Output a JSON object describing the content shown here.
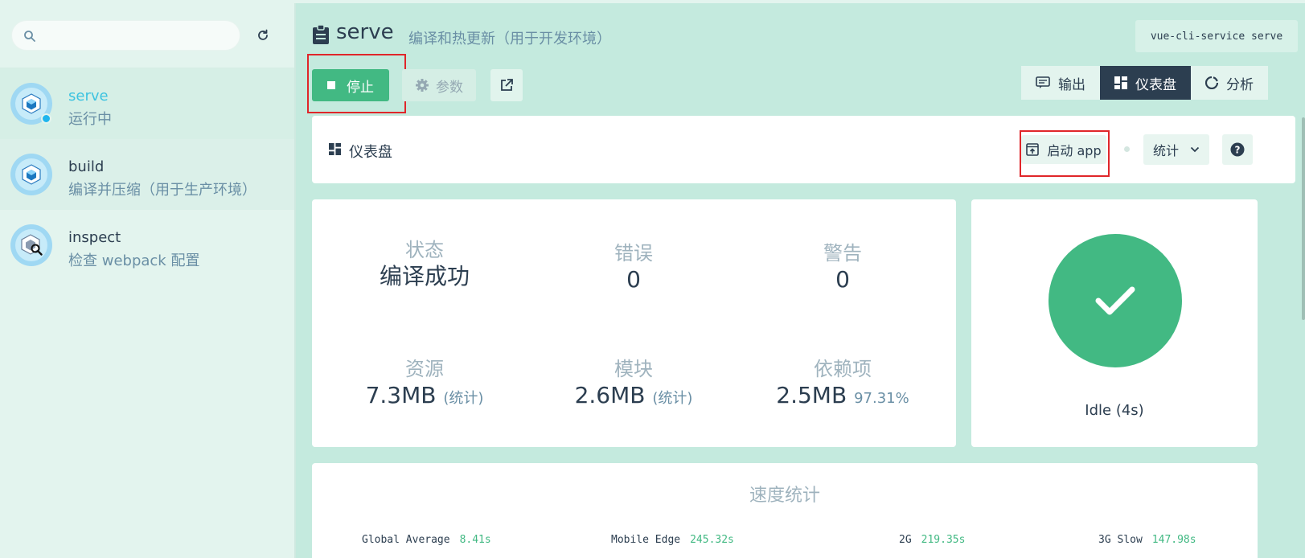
{
  "search": {
    "placeholder": "",
    "value": ""
  },
  "tasks": [
    {
      "name": "serve",
      "description": "运行中"
    },
    {
      "name": "build",
      "description": "编译并压缩（用于生产环境）"
    },
    {
      "name": "inspect",
      "description": "检查 webpack 配置"
    }
  ],
  "header": {
    "title": "serve",
    "subtitle": "编译和热更新（用于开发环境）",
    "command": "vue-cli-service serve"
  },
  "toolbar": {
    "stop_label": "停止",
    "params_label": "参数"
  },
  "view_tabs": [
    {
      "label": "输出",
      "icon": "output-icon",
      "active": false
    },
    {
      "label": "仪表盘",
      "icon": "dashboard-icon",
      "active": true
    },
    {
      "label": "分析",
      "icon": "analyze-icon",
      "active": false
    }
  ],
  "dashboard": {
    "title": "仪表盘",
    "launch_label": "启动 app",
    "stats_label": "统计"
  },
  "stats": {
    "status": {
      "label": "状态",
      "value": "编译成功"
    },
    "errors": {
      "label": "错误",
      "value": "0"
    },
    "warnings": {
      "label": "警告",
      "value": "0"
    },
    "assets": {
      "label": "资源",
      "value": "7.3MB",
      "extra": "(统计)"
    },
    "modules": {
      "label": "模块",
      "value": "2.6MB",
      "extra": "(统计)"
    },
    "deps": {
      "label": "依赖项",
      "value": "2.5MB",
      "extra": "97.31%"
    }
  },
  "build_status": {
    "text": "Idle (4s)"
  },
  "speed": {
    "title": "速度统计",
    "items": [
      {
        "label": "Global Average",
        "value": "8.41s"
      },
      {
        "label": "Mobile Edge",
        "value": "245.32s"
      },
      {
        "label": "2G",
        "value": "219.35s"
      },
      {
        "label": "3G Slow",
        "value": "147.98s"
      }
    ]
  },
  "colors": {
    "accent": "#42b983",
    "dark": "#2c3e50",
    "background": "#c4eade",
    "running": "#1fb5ed",
    "highlight": "#e0262a"
  }
}
